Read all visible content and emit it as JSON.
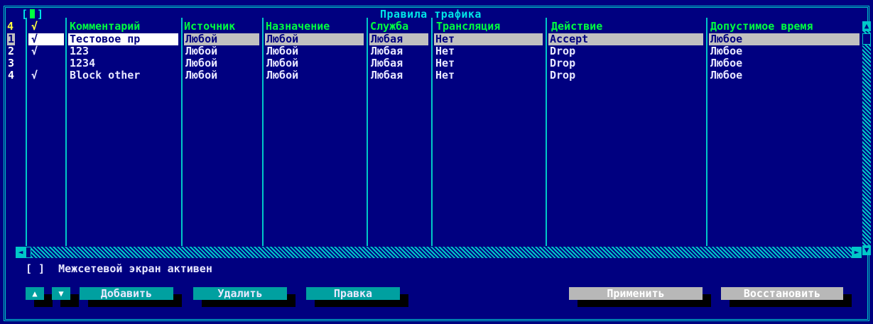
{
  "window": {
    "title": "Правила трафика",
    "count": "4"
  },
  "columns": {
    "check": "√",
    "comment": "Комментарий",
    "source": "Источник",
    "destination": "Назначение",
    "service": "Служба",
    "translation": "Трансляция",
    "action": "Действие",
    "allowed_time": "Допустимое время"
  },
  "rows": [
    {
      "num": "1",
      "check": "√",
      "comment": "Тестовое пр",
      "source": "Любой",
      "destination": "Любой",
      "service": "Любая",
      "translation": "Нет",
      "action": "Accept",
      "allowed_time": "Любое"
    },
    {
      "num": "2",
      "check": "√",
      "comment": "123",
      "source": "Любой",
      "destination": "Любой",
      "service": "Любая",
      "translation": "Нет",
      "action": "Drop",
      "allowed_time": "Любое"
    },
    {
      "num": "3",
      "check": "",
      "comment": "1234",
      "source": "Любой",
      "destination": "Любой",
      "service": "Любая",
      "translation": "Нет",
      "action": "Drop",
      "allowed_time": "Любое"
    },
    {
      "num": "4",
      "check": "√",
      "comment": "Block other",
      "source": "Любой",
      "destination": "Любой",
      "service": "Любая",
      "translation": "Нет",
      "action": "Drop",
      "allowed_time": "Любое"
    }
  ],
  "firewall": {
    "checkbox": "[ ]",
    "label": "Межсетевой экран активен"
  },
  "buttons": {
    "up": "▲",
    "down": "▼",
    "add": "Добавить",
    "delete": "Удалить",
    "edit": "Правка",
    "apply": "Применить",
    "restore": "Восстановить"
  },
  "colors": {
    "background": "#000080",
    "frame": "#00c8c8",
    "header": "#ffff40",
    "selection": "#c0c0c0"
  }
}
